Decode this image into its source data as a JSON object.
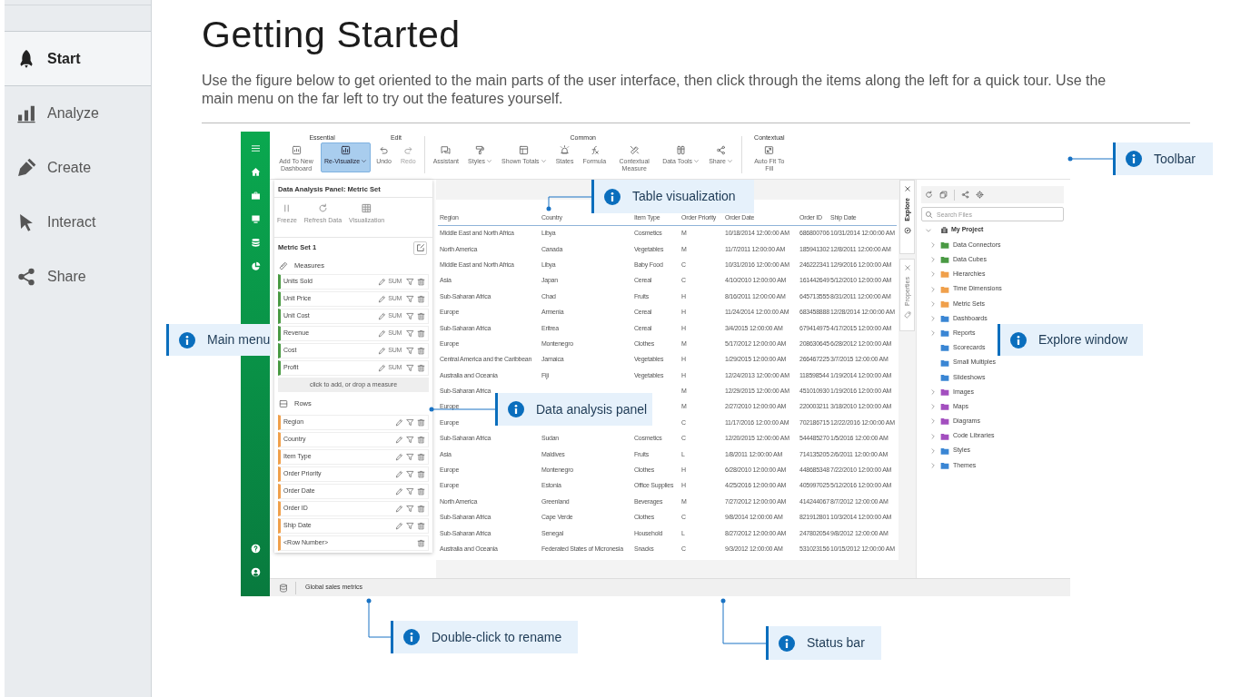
{
  "nav": [
    {
      "label": "Start",
      "selected": true
    },
    {
      "label": "Analyze",
      "selected": false
    },
    {
      "label": "Create",
      "selected": false
    },
    {
      "label": "Interact",
      "selected": false
    },
    {
      "label": "Share",
      "selected": false
    }
  ],
  "page": {
    "title": "Getting Started",
    "intro": "Use the figure below to get oriented to the main parts of the user interface, then click through the items along the left for a quick tour. Use the main menu on the far left to try out the features yourself."
  },
  "app": {
    "toolbar": {
      "groups": [
        {
          "title": "Essential",
          "items": [
            {
              "label": "Add To New Dashboard",
              "dropdown": false,
              "selected": false,
              "disabled": false
            },
            {
              "label": "Re-Visualize",
              "dropdown": true,
              "selected": true,
              "disabled": false
            }
          ]
        },
        {
          "title": "Edit",
          "items": [
            {
              "label": "Undo",
              "dropdown": false,
              "selected": false,
              "disabled": false
            },
            {
              "label": "Redo",
              "dropdown": false,
              "selected": false,
              "disabled": true
            }
          ]
        },
        {
          "title": "Common",
          "items": [
            {
              "label": "Assistant",
              "dropdown": false,
              "selected": false,
              "disabled": false
            },
            {
              "label": "Styles",
              "dropdown": true,
              "selected": false,
              "disabled": false
            },
            {
              "label": "Shown Totals",
              "dropdown": true,
              "selected": false,
              "disabled": false
            },
            {
              "label": "States",
              "dropdown": false,
              "selected": false,
              "disabled": false
            },
            {
              "label": "Formula",
              "dropdown": false,
              "selected": false,
              "disabled": false
            },
            {
              "label": "Contextual Measure",
              "dropdown": false,
              "selected": false,
              "disabled": false
            },
            {
              "label": "Data Tools",
              "dropdown": true,
              "selected": false,
              "disabled": false
            },
            {
              "label": "Share",
              "dropdown": true,
              "selected": false,
              "disabled": false
            }
          ]
        },
        {
          "title": "Contextual",
          "items": [
            {
              "label": "Auto Fit To Fill",
              "dropdown": false,
              "selected": false,
              "disabled": false
            }
          ]
        }
      ]
    },
    "data_panel": {
      "title": "Data Analysis Panel: Metric Set",
      "tools": [
        "Freeze",
        "Refresh Data",
        "Visualization"
      ],
      "metric_set": "Metric Set 1",
      "measures_label": "Measures",
      "measures": [
        {
          "name": "Units Sold",
          "aggregate": "SUM"
        },
        {
          "name": "Unit Price",
          "aggregate": "SUM"
        },
        {
          "name": "Unit Cost",
          "aggregate": "SUM"
        },
        {
          "name": "Revenue",
          "aggregate": "SUM"
        },
        {
          "name": "Cost",
          "aggregate": "SUM"
        },
        {
          "name": "Profit",
          "aggregate": "SUM"
        }
      ],
      "drop_hint": {
        "link": "click to add",
        "text": ", or drop a measure"
      },
      "rows_label": "Rows",
      "rows": [
        {
          "name": "Region",
          "editable": true
        },
        {
          "name": "Country",
          "editable": true
        },
        {
          "name": "Item Type",
          "editable": true
        },
        {
          "name": "Order Priority",
          "editable": true
        },
        {
          "name": "Order Date",
          "editable": true
        },
        {
          "name": "Order ID",
          "editable": true
        },
        {
          "name": "Ship Date",
          "editable": true
        },
        {
          "name": "<Row Number>",
          "editable": false
        }
      ]
    },
    "table": {
      "columns": [
        "Region",
        "Country",
        "Item Type",
        "Order Priority",
        "Order Date",
        "Order ID",
        "Ship Date"
      ],
      "rows": [
        [
          "Middle East and North Africa",
          "Libya",
          "Cosmetics",
          "M",
          "10/18/2014 12:00:00 AM",
          "686800706",
          "10/31/2014 12:00:00 AM"
        ],
        [
          "North America",
          "Canada",
          "Vegetables",
          "M",
          "11/7/2011 12:00:00 AM",
          "185941302",
          "12/8/2011 12:00:00 AM"
        ],
        [
          "Middle East and North Africa",
          "Libya",
          "Baby Food",
          "C",
          "10/31/2016 12:00:00 AM",
          "246222341",
          "12/9/2016 12:00:00 AM"
        ],
        [
          "Asia",
          "Japan",
          "Cereal",
          "C",
          "4/10/2010 12:00:00 AM",
          "161442649",
          "5/12/2010 12:00:00 AM"
        ],
        [
          "Sub-Saharan Africa",
          "Chad",
          "Fruits",
          "H",
          "8/16/2011 12:00:00 AM",
          "645713555",
          "8/31/2011 12:00:00 AM"
        ],
        [
          "Europe",
          "Armenia",
          "Cereal",
          "H",
          "11/24/2014 12:00:00 AM",
          "683458888",
          "12/28/2014 12:00:00 AM"
        ],
        [
          "Sub-Saharan Africa",
          "Eritrea",
          "Cereal",
          "H",
          "3/4/2015 12:00:00 AM",
          "679414975",
          "4/17/2015 12:00:00 AM"
        ],
        [
          "Europe",
          "Montenegro",
          "Clothes",
          "M",
          "5/17/2012 12:00:00 AM",
          "208630645",
          "6/28/2012 12:00:00 AM"
        ],
        [
          "Central America and the Caribbean",
          "Jamaica",
          "Vegetables",
          "H",
          "1/29/2015 12:00:00 AM",
          "266467225",
          "3/7/2015 12:00:00 AM"
        ],
        [
          "Australia and Oceania",
          "Fiji",
          "Vegetables",
          "H",
          "12/24/2013 12:00:00 AM",
          "118598544",
          "1/19/2014 12:00:00 AM"
        ],
        [
          "Sub-Saharan Africa",
          null,
          null,
          "M",
          "12/29/2015 12:00:00 AM",
          "451010930",
          "1/19/2016 12:00:00 AM"
        ],
        [
          "Europe",
          null,
          null,
          "M",
          "2/27/2010 12:00:00 AM",
          "220003211",
          "3/18/2010 12:00:00 AM"
        ],
        [
          "Europe",
          null,
          null,
          "C",
          "11/17/2016 12:00:00 AM",
          "702186715",
          "12/22/2016 12:00:00 AM"
        ],
        [
          "Sub-Saharan Africa",
          "Sudan",
          "Cosmetics",
          "C",
          "12/20/2015 12:00:00 AM",
          "544485270",
          "1/5/2016 12:00:00 AM"
        ],
        [
          "Asia",
          "Maldives",
          "Fruits",
          "L",
          "1/8/2011 12:00:00 AM",
          "714135205",
          "2/6/2011 12:00:00 AM"
        ],
        [
          "Europe",
          "Montenegro",
          "Clothes",
          "H",
          "6/28/2010 12:00:00 AM",
          "448685348",
          "7/22/2010 12:00:00 AM"
        ],
        [
          "Europe",
          "Estonia",
          "Office Supplies",
          "H",
          "4/25/2016 12:00:00 AM",
          "405997025",
          "5/12/2016 12:00:00 AM"
        ],
        [
          "North America",
          "Greenland",
          "Beverages",
          "M",
          "7/27/2012 12:00:00 AM",
          "414244067",
          "8/7/2012 12:00:00 AM"
        ],
        [
          "Sub-Saharan Africa",
          "Cape Verde",
          "Clothes",
          "C",
          "9/8/2014 12:00:00 AM",
          "821912801",
          "10/3/2014 12:00:00 AM"
        ],
        [
          "Sub-Saharan Africa",
          "Senegal",
          "Household",
          "L",
          "8/27/2012 12:00:00 AM",
          "247802054",
          "9/8/2012 12:00:00 AM"
        ],
        [
          "Australia and Oceania",
          "Federated States of Micronesia",
          "Snacks",
          "C",
          "9/3/2012 12:00:00 AM",
          "531023156",
          "10/15/2012 12:00:00 AM"
        ]
      ]
    },
    "side_tabs": [
      {
        "label": "Explore",
        "selected": true
      },
      {
        "label": "Properties",
        "selected": false
      }
    ],
    "explore": {
      "search_placeholder": "Search Files",
      "project": {
        "name": "My Project",
        "expanded": true,
        "children": [
          {
            "name": "Data Connectors",
            "color": "#4a9a44",
            "expandable": true
          },
          {
            "name": "Data Cubes",
            "color": "#4a9a44",
            "expandable": true
          },
          {
            "name": "Hierarchies",
            "color": "#f0a04b",
            "expandable": true
          },
          {
            "name": "Time Dimensions",
            "color": "#f0a04b",
            "expandable": true
          },
          {
            "name": "Metric Sets",
            "color": "#f0a04b",
            "expandable": true
          },
          {
            "name": "Dashboards",
            "color": "#3a86d4",
            "expandable": true
          },
          {
            "name": "Reports",
            "color": "#3a86d4",
            "expandable": true
          },
          {
            "name": "Scorecards",
            "color": "#3a86d4",
            "expandable": false
          },
          {
            "name": "Small Multiples",
            "color": "#3a86d4",
            "expandable": false
          },
          {
            "name": "Slideshows",
            "color": "#3a86d4",
            "expandable": false
          },
          {
            "name": "Images",
            "color": "#a34fbf",
            "expandable": true
          },
          {
            "name": "Maps",
            "color": "#a34fbf",
            "expandable": true
          },
          {
            "name": "Diagrams",
            "color": "#a34fbf",
            "expandable": true
          },
          {
            "name": "Code Libraries",
            "color": "#a34fbf",
            "expandable": true
          },
          {
            "name": "Styles",
            "color": "#3a86d4",
            "expandable": true
          },
          {
            "name": "Themes",
            "color": "#3a86d4",
            "expandable": true
          }
        ]
      }
    },
    "status_bar": {
      "text": "Global sales metrics"
    }
  },
  "callouts": [
    {
      "text": "Table visualization"
    },
    {
      "text": "Toolbar"
    },
    {
      "text": "Main menu"
    },
    {
      "text": "Explore window"
    },
    {
      "text": "Data analysis panel"
    },
    {
      "text": "Double-click to rename"
    },
    {
      "text": "Status bar"
    }
  ]
}
